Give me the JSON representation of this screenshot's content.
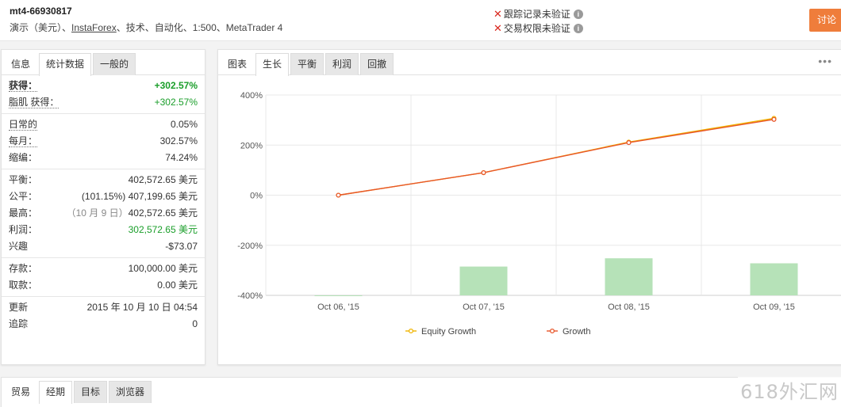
{
  "header": {
    "title": "mt4-66930817",
    "meta_prefix": "演示（美元）、",
    "meta_broker": "InstaForex",
    "meta_suffix": "、技术、自动化、1:500、MetaTrader 4",
    "verify_track": "跟踪记录未验证",
    "verify_trade": "交易权限未验证",
    "discuss_label": "讨论",
    "info_glyph": "i",
    "x_glyph": "✕"
  },
  "left_tabs": [
    {
      "label": "信息"
    },
    {
      "label": "统计数据"
    },
    {
      "label": "一般的"
    }
  ],
  "stats": {
    "gain_label": "获得：",
    "gain_value": "+302.57%",
    "abs_gain_label": "脂肌 获得：",
    "abs_gain_value": "+302.57%",
    "daily_label": "日常的",
    "daily_value": "0.05%",
    "monthly_label": "每月：",
    "monthly_value": "302.57%",
    "drawdown_label": "缩编：",
    "drawdown_value": "74.24%",
    "balance_label": "平衡：",
    "balance_value": "402,572.65 美元",
    "equity_label": "公平：",
    "equity_value": "(101.15%) 407,199.65 美元",
    "highest_label": "最高：",
    "highest_date": "（10 月 9 日）",
    "highest_value": "402,572.65 美元",
    "profit_label": "利润：",
    "profit_value": "302,572.65 美元",
    "interest_label": "兴趣",
    "interest_value": "-$73.07",
    "deposits_label": "存款：",
    "deposits_value": "100,000.00 美元",
    "withdrawals_label": "取款：",
    "withdrawals_value": "0.00 美元",
    "updated_label": "更新",
    "updated_value": "2015 年 10 月 10 日 04:54",
    "tracking_label": "追踪",
    "tracking_value": "0"
  },
  "chart_tabs": [
    {
      "label": "图表"
    },
    {
      "label": "生长"
    },
    {
      "label": "平衡"
    },
    {
      "label": "利润"
    },
    {
      "label": "回撤"
    }
  ],
  "chart_menu_glyph": "•••",
  "chart_data": {
    "type": "line",
    "categories": [
      "Oct 06, '15",
      "Oct 07, '15",
      "Oct 08, '15",
      "Oct 09, '15"
    ],
    "y_ticks": [
      "400%",
      "200%",
      "0%",
      "-200%",
      "-400%"
    ],
    "ylim": [
      -400,
      400
    ],
    "grid": true,
    "legend_position": "bottom",
    "series": [
      {
        "name": "Equity Growth",
        "type": "line",
        "color": "#f0b400",
        "values": [
          0,
          90,
          212,
          307
        ]
      },
      {
        "name": "Growth",
        "type": "line",
        "color": "#e8562a",
        "values": [
          0,
          90,
          210,
          302.57
        ]
      }
    ],
    "bars": {
      "color": "#b6e2b8",
      "values": [
        -400,
        -285,
        -252,
        -272
      ]
    }
  },
  "bottom_tabs": [
    {
      "label": "贸易"
    },
    {
      "label": "经期"
    },
    {
      "label": "目标"
    },
    {
      "label": "浏览器"
    }
  ],
  "watermark": "618外汇网"
}
